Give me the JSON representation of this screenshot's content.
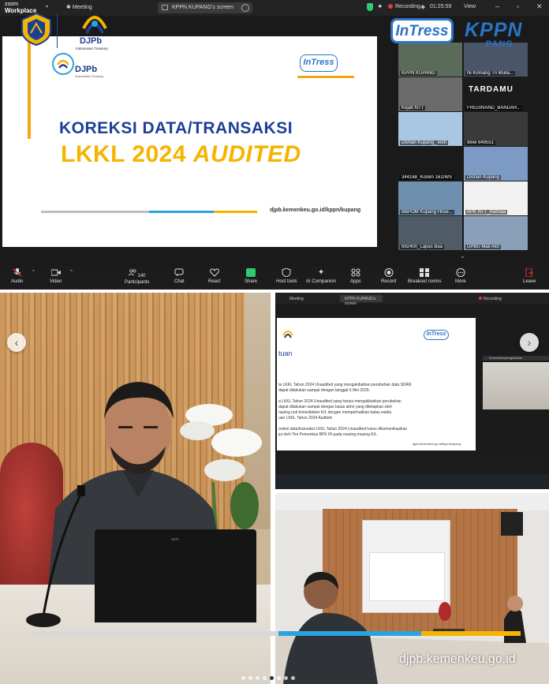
{
  "zoom": {
    "app_name_line1": "zoom",
    "app_name_line2": "Workplace",
    "meeting_label": "Meeting",
    "share_title": "KPPN KUPANG's screen",
    "recording_label": "Recording",
    "timer": "01:25:59",
    "view_label": "View",
    "toolbar": {
      "audio": "Audio",
      "video": "Video",
      "participants": "Participants",
      "participants_count": "140",
      "chat": "Chat",
      "react": "React",
      "share": "Share",
      "host_tools": "Host tools",
      "ai_companion": "AI Companion",
      "apps": "Apps",
      "record": "Record",
      "breakout_rooms": "Breakout rooms",
      "more": "More",
      "leave": "Leave"
    },
    "participants": [
      {
        "name": "KPPN KUPANG"
      },
      {
        "name": "Ni Komang Tri Mulia..."
      },
      {
        "name": "Kejati NTT"
      },
      {
        "name": "FREDINAND_BANDAR..."
      },
      {
        "name": "Dishan Kupang_Tesh"
      },
      {
        "name": "dewi 649551"
      },
      {
        "name": "344168_Korem 161/WS"
      },
      {
        "name": "Dishan Kupang"
      },
      {
        "name": "BBPOM Kupang Hose..."
      },
      {
        "name": "BPK NTT_Ramala"
      },
      {
        "name": "692400_Lapas Baa"
      },
      {
        "name": "UPBU Mali Alor"
      }
    ],
    "gallery_tile_text": "TARDAMU"
  },
  "slide": {
    "logo_text": "DJPb",
    "logo_subtext": "Indonesian Treasury",
    "intress_logo": "InTress",
    "title_line1": "KOREKSI DATA/TRANSAKSI",
    "title_line2_a": "LKKL 2024",
    "title_line2_b": "AUDITED",
    "url": "djpb.kemenkeu.go.id/kppn/kupang"
  },
  "overlay": {
    "djpb_logo_text": "DJPb",
    "djpb_logo_subtext": "Indonesian Treasury",
    "intress_logo": "InTress",
    "kppn_logo": "KPPN",
    "kppn_logo_sub": "PANG",
    "bottom_url": "djpb.kemenkeu.go.id"
  },
  "photo_left": {
    "laptop_brand": "acer"
  },
  "screen_right": {
    "meeting_label": "Meeting",
    "share_title": "KPPN KUPANG's screen",
    "recording_label": "Recording",
    "slide_heading": "tuan",
    "slide_lines": [
      "ta LKKL Tahun 2024 Unaudited yang mengakibatkan perubahan data SDAN",
      "dapat dilakukan sampai dengan tanggal 6 Mei 2025;",
      "",
      "a LKKL Tahun 2024 Unaudited yang hanya mengakibatkan perubahan",
      "dapat dilakukan sampai dengan batas akhir yang ditetapkan oleh",
      "nasing unit konsolidator K/L dengan memperhatikan batas waktu",
      "uan LKKL Tahun 2024 Audited;",
      "",
      "oreksi data/transaksi LKKL Tahun 2024 Unaudited harus dikomunikasikan",
      "jui oleh Tim Pemeriksa BPK RI pada masing-masing K/L."
    ],
    "slide_url": "djpb.kemenkeu.go.id/kppn/kupang",
    "side_panel_label": "Kemenkeu/pengelolaan"
  },
  "colors": {
    "navy": "#1c3f95",
    "gold": "#f4b400",
    "accent_blue": "#2aa3df",
    "zoom_green": "#2ecc71",
    "record_red": "#e53935"
  }
}
